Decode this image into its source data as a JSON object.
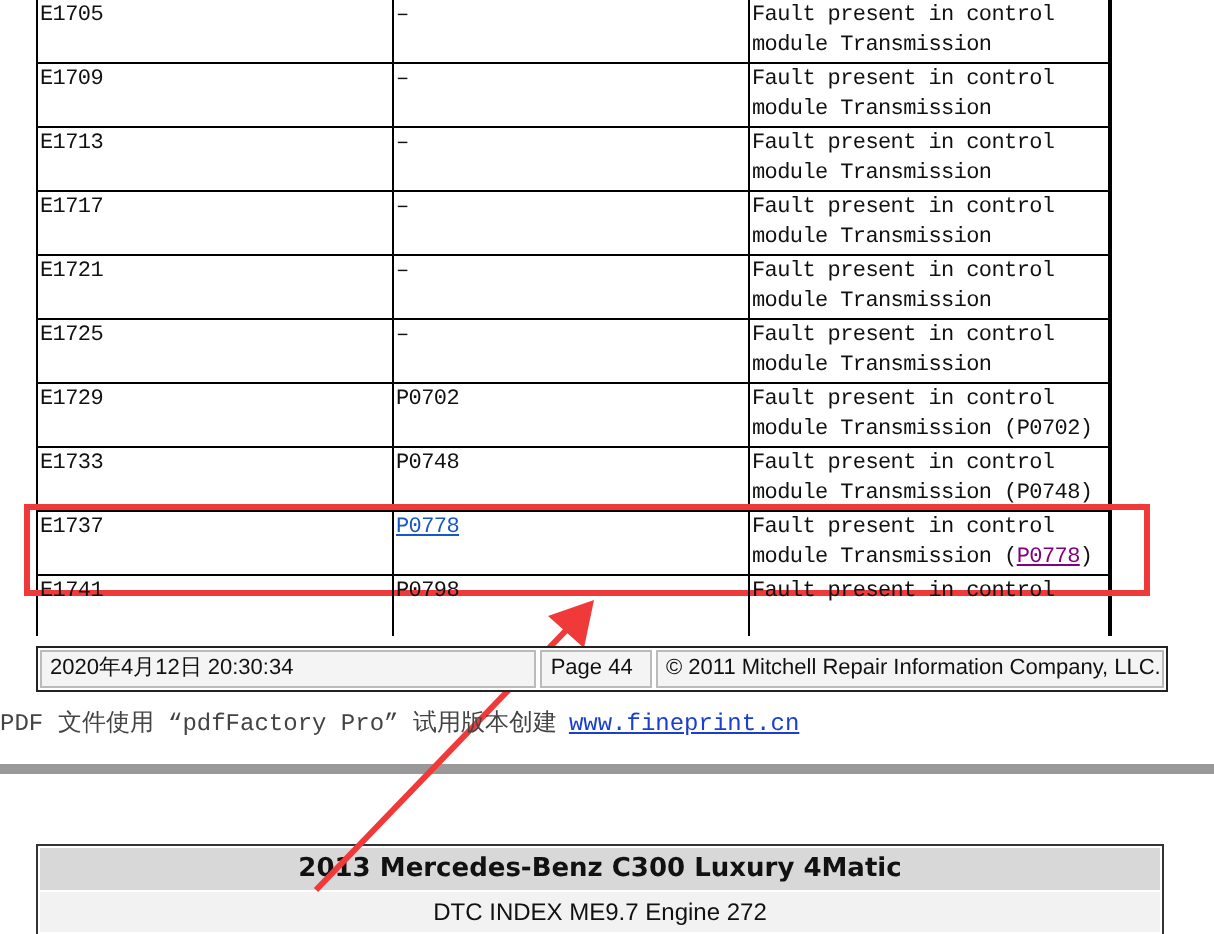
{
  "table": {
    "rows": [
      {
        "code": "E1705",
        "pcode": "–",
        "pcode_link": false,
        "description": "Fault present in control module Transmission",
        "highlighted": false
      },
      {
        "code": "E1709",
        "pcode": "–",
        "pcode_link": false,
        "description": "Fault present in control module Transmission",
        "highlighted": false
      },
      {
        "code": "E1713",
        "pcode": "–",
        "pcode_link": false,
        "description": "Fault present in control module Transmission",
        "highlighted": false
      },
      {
        "code": "E1717",
        "pcode": "–",
        "pcode_link": false,
        "description": "Fault present in control module Transmission",
        "highlighted": false
      },
      {
        "code": "E1721",
        "pcode": "–",
        "pcode_link": false,
        "description": "Fault present in control module Transmission",
        "highlighted": false
      },
      {
        "code": "E1725",
        "pcode": "–",
        "pcode_link": false,
        "description": "Fault present in control module Transmission",
        "highlighted": false
      },
      {
        "code": "E1729",
        "pcode": "P0702",
        "pcode_link": false,
        "description": "Fault present in control module Transmission",
        "ref_before": "(",
        "ref": "P0702",
        "ref_after": ")",
        "ref_link": false,
        "highlighted": false
      },
      {
        "code": "E1733",
        "pcode": "P0748",
        "pcode_link": false,
        "description": "Fault present in control module Transmission",
        "ref_before": "(",
        "ref": "P0748",
        "ref_after": ")",
        "ref_link": false,
        "highlighted": false
      },
      {
        "code": "E1737",
        "pcode": "P0778",
        "pcode_link": true,
        "pcode_visited": false,
        "description": "Fault present in control module Transmission",
        "ref_before": "(",
        "ref": "P0778",
        "ref_after": ")",
        "ref_link": true,
        "ref_visited": true,
        "highlighted": true
      },
      {
        "code": "E1741",
        "pcode": "P0798",
        "pcode_link": false,
        "description": "Fault present in control",
        "highlighted": false
      }
    ]
  },
  "footer": {
    "date": "2020年4月12日  20:30:34",
    "page": "Page 44",
    "copyright": "© 2011 Mitchell Repair Information Company, LLC."
  },
  "pdf_notice": {
    "text": "PDF 文件使用 “pdfFactory Pro” 试用版本创建",
    "link": "www.fineprint.cn"
  },
  "next_page": {
    "title": "2013 Mercedes-Benz C300 Luxury 4Matic",
    "subtitle": "DTC INDEX ME9.7 Engine 272"
  }
}
